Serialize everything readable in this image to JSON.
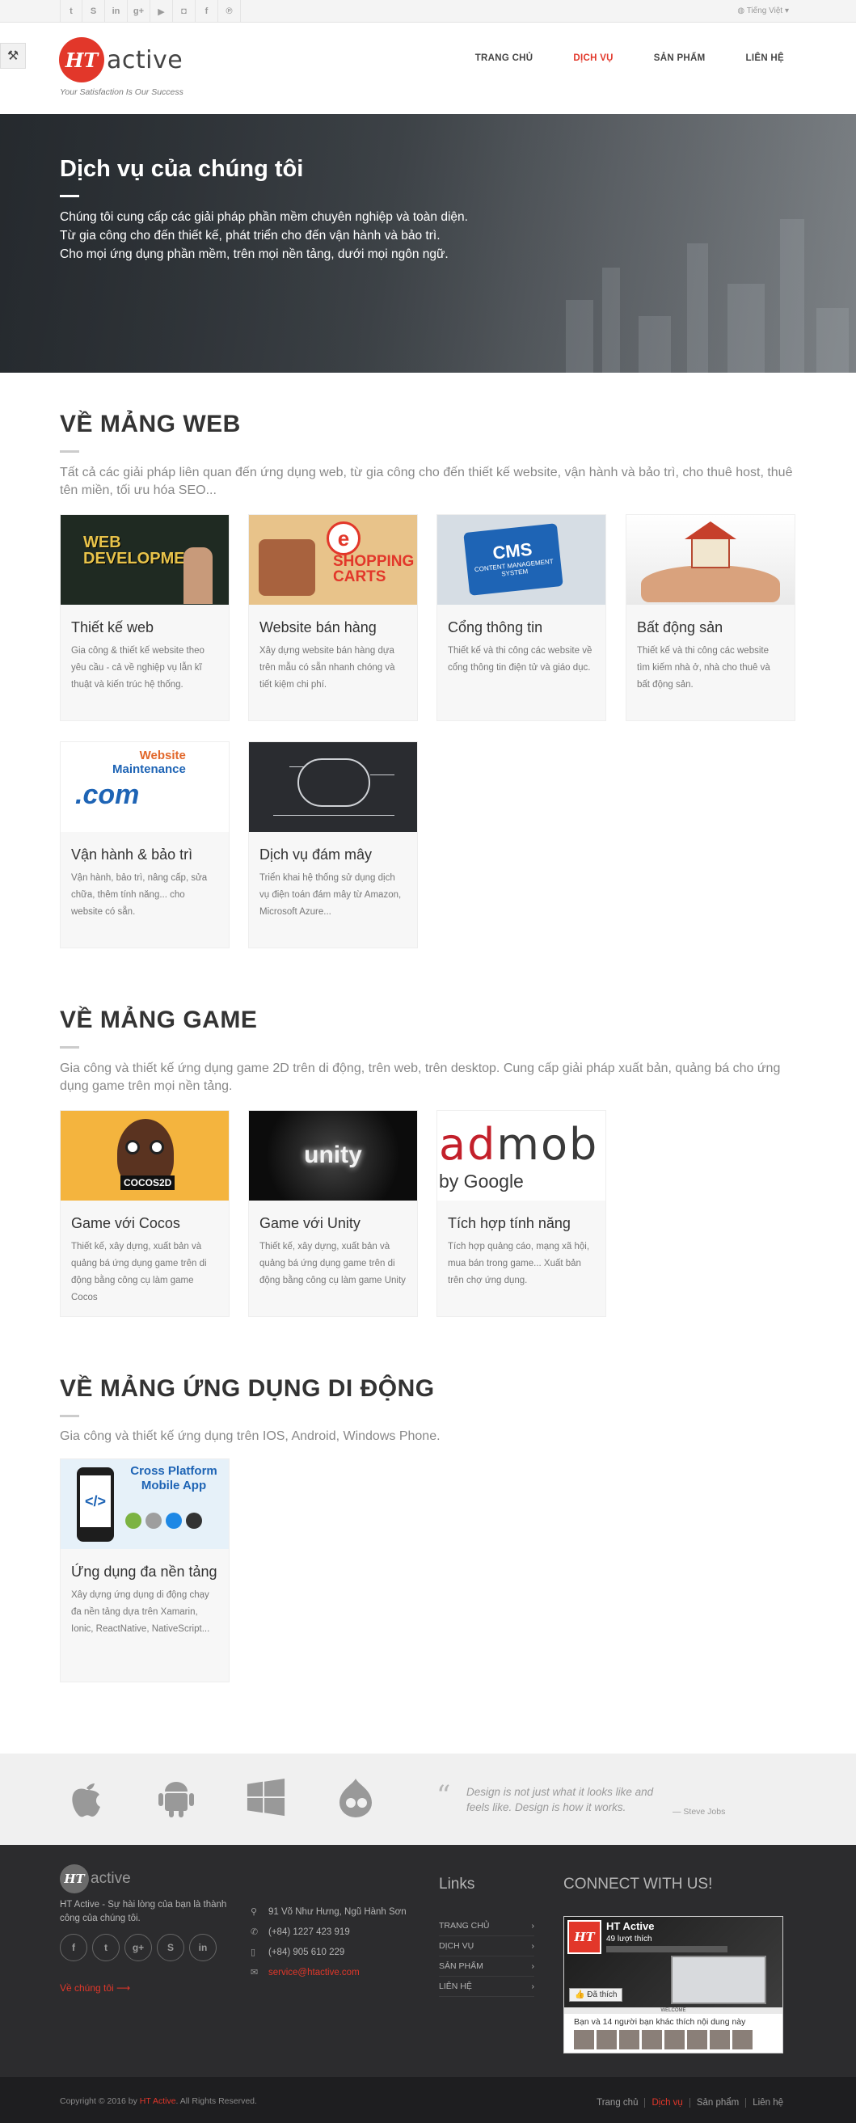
{
  "topbar": {
    "social": [
      "t",
      "S",
      "in",
      "g+",
      "▶",
      "◘",
      "f",
      "℗"
    ],
    "social_icons": [
      "twitter-icon",
      "skype-icon",
      "linkedin-icon",
      "googleplus-icon",
      "youtube-icon",
      "flickr-icon",
      "facebook-icon",
      "pinterest-icon"
    ],
    "language": "Tiếng Việt"
  },
  "header": {
    "logo_mark": "HT",
    "logo_word": "active",
    "tagline": "Your Satisfaction Is Our Success",
    "nav": [
      "TRANG CHỦ",
      "DỊCH VỤ",
      "SẢN PHẨM",
      "LIÊN HỆ"
    ],
    "nav_active": "DỊCH VỤ",
    "accent": "#e2372a"
  },
  "hero": {
    "title": "Dịch vụ của chúng tôi",
    "line1": "Chúng tôi cung cấp các giải pháp phần mềm chuyên nghiệp và toàn diện.",
    "line2": "Từ gia công cho đến thiết kế, phát triển cho đến vận hành và bảo trì.",
    "line3": "Cho mọi ứng dụng phần mềm, trên mọi nền tảng, dưới mọi ngôn ngữ."
  },
  "web": {
    "title": "VỀ MẢNG WEB",
    "desc": "Tất cả các giải pháp liên quan đến ứng dụng web, từ gia công cho đến thiết kế website, vận hành và bảo trì, cho thuê host, thuê tên miền, tối ưu hóa SEO...",
    "cards": [
      {
        "title": "Thiết kế web",
        "text": "Gia công & thiết kế website theo yêu cầu - cả về nghiệp vụ lẫn kĩ thuật và kiến trúc hệ thống.",
        "img": [
          "WEB",
          "DEVELOPMENT"
        ]
      },
      {
        "title": "Website bán hàng",
        "text": "Xây dựng website bán hàng dựa trên mẫu có sẵn nhanh chóng và tiết kiệm chi phí.",
        "img": [
          "e",
          "SHOPPING",
          "CARTS"
        ]
      },
      {
        "title": "Cổng thông tin",
        "text": "Thiết kế và thi công các website về cổng thông tin điện tử và giáo dục.",
        "img": [
          "CMS",
          "CONTENT MANAGEMENT SYSTEM"
        ]
      },
      {
        "title": "Bất động sản",
        "text": "Thiết kế và thi công các website tìm kiếm nhà ở, nhà cho thuê và bất động sản."
      },
      {
        "title": "Vận hành & bảo trì",
        "text": "Vận hành, bảo trì, nâng cấp, sửa chữa, thêm tính năng... cho website có sẵn.",
        "img": [
          "Website",
          "Maintenance",
          ".com"
        ]
      },
      {
        "title": "Dịch vụ đám mây",
        "text": "Triển khai hệ thống sử dụng dịch vụ điện toán đám mây từ Amazon, Microsoft Azure..."
      }
    ]
  },
  "game": {
    "title": "VỀ MẢNG GAME",
    "desc": "Gia công và thiết kế ứng dụng game 2D trên di động, trên web, trên desktop. Cung cấp giải pháp xuất bản, quảng bá cho ứng dụng game trên mọi nền tảng.",
    "cards": [
      {
        "title": "Game với Cocos",
        "text": "Thiết kế, xây dựng, xuất bản và quảng bá ứng dụng game trên di động bằng công cụ làm game Cocos",
        "img": [
          "COCOS2D"
        ]
      },
      {
        "title": "Game với Unity",
        "text": "Thiết kế, xây dựng, xuất bản và quảng bá ứng dụng game trên di động bằng công cụ làm game Unity",
        "img": [
          "unity"
        ]
      },
      {
        "title": "Tích hợp tính năng",
        "text": "Tích hợp quảng cáo, mạng xã hội, mua bán trong game... Xuất bản trên chợ ứng dụng.",
        "img": [
          "ad",
          "mob",
          "by Google"
        ]
      }
    ]
  },
  "mobile": {
    "title": "VỀ MẢNG ỨNG DỤNG DI ĐỘNG",
    "desc": "Gia công và thiết kế ứng dụng trên IOS, Android, Windows Phone.",
    "cards": [
      {
        "title": "Ứng dụng đa nền tảng",
        "text": "Xây dựng ứng dụng di động chạy đa nền tảng dựa trên Xamarin, Ionic, ReactNative, NativeScript...",
        "img": [
          "Cross Platform",
          "Mobile App"
        ]
      }
    ]
  },
  "strip": {
    "platforms": [
      "apple-icon",
      "android-icon",
      "windows-icon",
      "drupal-icon"
    ],
    "quote": "Design is not just what it looks like and feels like. Design is how it works.",
    "author": "— Steve Jobs"
  },
  "footer": {
    "logo_mark": "HT",
    "logo_word": "active",
    "about": "HT Active - Sự hài lòng của bạn là thành công của chúng tôi.",
    "social": [
      "f",
      "t",
      "g+",
      "S",
      "in"
    ],
    "more": "Về chúng tôi  ⟶",
    "contact": {
      "address": "91 Võ Như Hưng, Ngũ Hành Sơn",
      "phone1": "(+84) 1227 423 919",
      "phone2": "(+84) 905 610 229",
      "email": "service@htactive.com"
    },
    "links_title": "Links",
    "links": [
      "TRANG CHỦ",
      "DỊCH VỤ",
      "SẢN PHẨM",
      "LIÊN HỆ"
    ],
    "connect_title": "CONNECT WITH US!",
    "fb": {
      "name": "HT Active",
      "likes": "49 lượt thích",
      "like_btn": "Đã thích",
      "welcome": "WELCOME",
      "friends": "Bạn và 14 người bạn khác thích nội dung này"
    }
  },
  "copyright": {
    "prefix": "Copyright © 2016 by ",
    "brand": "HT Active",
    "suffix": ". All Rights Reserved.",
    "nav": [
      "Trang chủ",
      "Dịch vụ",
      "Sản phẩm",
      "Liên hệ"
    ]
  }
}
